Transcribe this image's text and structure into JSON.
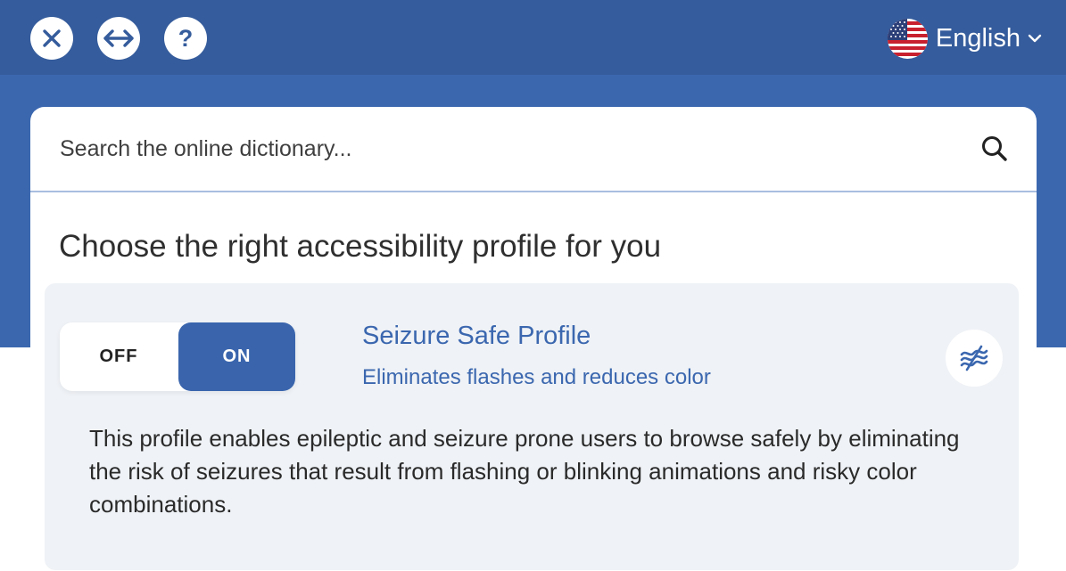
{
  "toolbar": {
    "close_icon": "close-icon",
    "resize_icon": "resize-horizontal-icon",
    "help_icon": "help-icon",
    "help_glyph": "?",
    "language": {
      "label": "English",
      "flag_icon": "us-flag-icon",
      "chevron_icon": "chevron-down-icon"
    }
  },
  "search": {
    "placeholder": "Search the online dictionary...",
    "value": "",
    "icon": "search-icon"
  },
  "section": {
    "title": "Choose the right accessibility profile for you"
  },
  "profile": {
    "toggle": {
      "off_label": "OFF",
      "on_label": "ON",
      "state": "on"
    },
    "name": "Seizure Safe Profile",
    "tagline": "Eliminates flashes and reduces color",
    "icon": "waves-icon",
    "description": "This profile enables epileptic and seizure prone users to browse safely by eliminating the risk of seizures that result from flashing or blinking animations and risky color combinations."
  },
  "colors": {
    "toolbar": "#355c9c",
    "band": "#3b67af",
    "accent": "#3a65ad",
    "profile_bg": "#eff2f6"
  }
}
